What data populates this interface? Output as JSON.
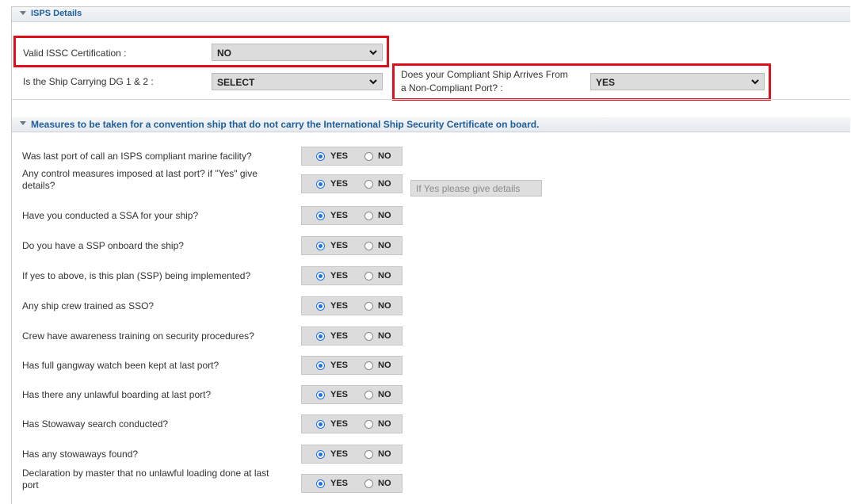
{
  "isps": {
    "header": "ISPS Details",
    "valid_issc": {
      "label": "Valid ISSC Certification :",
      "value": "NO"
    },
    "dg": {
      "label": "Is the Ship Carrying DG 1 & 2 :",
      "value": "SELECT"
    },
    "compliant": {
      "label_line1": "Does your Compliant Ship Arrives From",
      "label_line2": "a Non-Compliant Port? :",
      "value": "YES"
    }
  },
  "measures": {
    "header": "Measures to be taken for a convention ship that do not carry the International Ship Security Certificate on board.",
    "yes_label": "YES",
    "no_label": "NO",
    "details_placeholder": "If Yes please give details",
    "questions": [
      {
        "line1": "Was last port of call an ISPS compliant marine facility?",
        "line2": "",
        "answer": "YES"
      },
      {
        "line1": "Any control measures imposed at last port? if \"Yes\" give",
        "line2": "details?",
        "answer": "YES"
      },
      {
        "line1": "Have you conducted a SSA for your ship?",
        "line2": "",
        "answer": "YES"
      },
      {
        "line1": "Do you have a SSP onboard the ship?",
        "line2": "",
        "answer": "YES"
      },
      {
        "line1": "If yes to above, is this plan (SSP) being implemented?",
        "line2": "",
        "answer": "YES"
      },
      {
        "line1": "Any ship crew trained as SSO?",
        "line2": "",
        "answer": "YES"
      },
      {
        "line1": "Crew have awareness training on security procedures?",
        "line2": "",
        "answer": "YES"
      },
      {
        "line1": "Has full gangway watch been kept at last port?",
        "line2": "",
        "answer": "YES"
      },
      {
        "line1": "Has there any unlawful boarding at last port?",
        "line2": "",
        "answer": "YES"
      },
      {
        "line1": "Has Stowaway search conducted?",
        "line2": "",
        "answer": "YES"
      },
      {
        "line1": "Has any stowaways found?",
        "line2": "",
        "answer": "YES"
      },
      {
        "line1": "Declaration by master that no unlawful loading done at last",
        "line2": "port",
        "answer": "YES"
      }
    ]
  },
  "colors": {
    "highlight": "#e0101a",
    "accent": "#1a73e8",
    "header_text": "#1d5e9c"
  }
}
